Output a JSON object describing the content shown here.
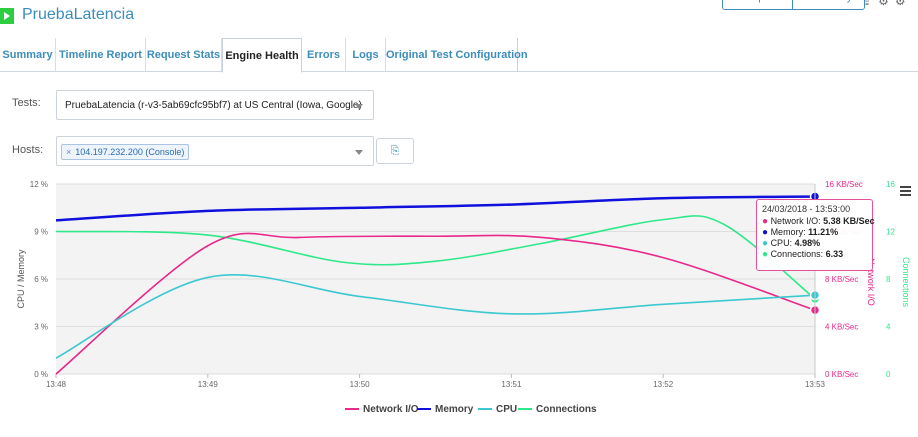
{
  "header": {
    "title": "PruebaLatencia",
    "compare_label": "Compare",
    "summary_label": "Summary"
  },
  "tabs": [
    {
      "label": "Summary"
    },
    {
      "label": "Timeline Report"
    },
    {
      "label": "Request Stats"
    },
    {
      "label": "Engine Health",
      "active": true
    },
    {
      "label": "Errors"
    },
    {
      "label": "Logs"
    },
    {
      "label": "Original Test Configuration"
    }
  ],
  "filters": {
    "tests_label": "Tests:",
    "tests_value": "PruebaLatencia (r-v3-5ab69cfc95bf7) at US Central (Iowa, Google)",
    "hosts_label": "Hosts:",
    "host_chip": "104.197.232.200 (Console)",
    "host_chip_remove": "×"
  },
  "tooltip": {
    "time": "24/03/2018 - 13:53:00",
    "rows": [
      {
        "label": "Network I/O: ",
        "value": "5.38 KB/Sec",
        "color": "#e8288a"
      },
      {
        "label": "Memory: ",
        "value": "11.21%",
        "color": "#1010dd"
      },
      {
        "label": "CPU: ",
        "value": "4.98%",
        "color": "#3cc8d0"
      },
      {
        "label": "Connections: ",
        "value": "6.33",
        "color": "#2ee88a"
      }
    ]
  },
  "chart_data": {
    "type": "line",
    "x": [
      "13:48",
      "13:49",
      "13:50",
      "13:51",
      "13:52",
      "13:53"
    ],
    "xlim_minutes": [
      0,
      5
    ],
    "left_axis": {
      "label": "CPU / Memory",
      "ticks": [
        "0 %",
        "3 %",
        "6 %",
        "9 %",
        "12 %"
      ],
      "lim": [
        0,
        12
      ]
    },
    "right_axis_1": {
      "label": "Network I/O",
      "ticks": [
        "0 KB/Sec",
        "4 KB/Sec",
        "8 KB/Sec",
        "12 KB/Sec",
        "16 KB/Sec"
      ],
      "lim": [
        0,
        16
      ],
      "color": "#e8288a"
    },
    "right_axis_2": {
      "label": "Connections",
      "ticks": [
        "0",
        "4",
        "8",
        "12",
        "16"
      ],
      "lim": [
        0,
        16
      ],
      "color": "#2ee88a"
    },
    "series": [
      {
        "name": "Network I/O",
        "axis": "right_axis_1",
        "color": "#e8288a",
        "points": [
          [
            0,
            0
          ],
          [
            1,
            10.8
          ],
          [
            1.6,
            11.5
          ],
          [
            2.5,
            11.6
          ],
          [
            3.2,
            11.5
          ],
          [
            4,
            9.8
          ],
          [
            5,
            5.38
          ]
        ]
      },
      {
        "name": "Memory",
        "axis": "left_axis",
        "color": "#1010dd",
        "points": [
          [
            0,
            9.7
          ],
          [
            1,
            10.3
          ],
          [
            2,
            10.5
          ],
          [
            3,
            10.7
          ],
          [
            4,
            11.1
          ],
          [
            5,
            11.21
          ]
        ]
      },
      {
        "name": "CPU",
        "axis": "left_axis",
        "color": "#3cc8d0",
        "points": [
          [
            0,
            1.0
          ],
          [
            1,
            6.1
          ],
          [
            2,
            4.9
          ],
          [
            3,
            3.8
          ],
          [
            4,
            4.4
          ],
          [
            5,
            4.98
          ]
        ]
      },
      {
        "name": "Connections",
        "axis": "right_axis_2",
        "color": "#2ee88a",
        "points": [
          [
            0,
            12.0
          ],
          [
            1,
            11.7
          ],
          [
            1.9,
            9.4
          ],
          [
            2.5,
            9.5
          ],
          [
            3.2,
            11.0
          ],
          [
            4,
            13.0
          ],
          [
            4.4,
            12.6
          ],
          [
            5,
            6.33
          ]
        ]
      }
    ],
    "grid": true,
    "legend_position": "bottom-center"
  }
}
